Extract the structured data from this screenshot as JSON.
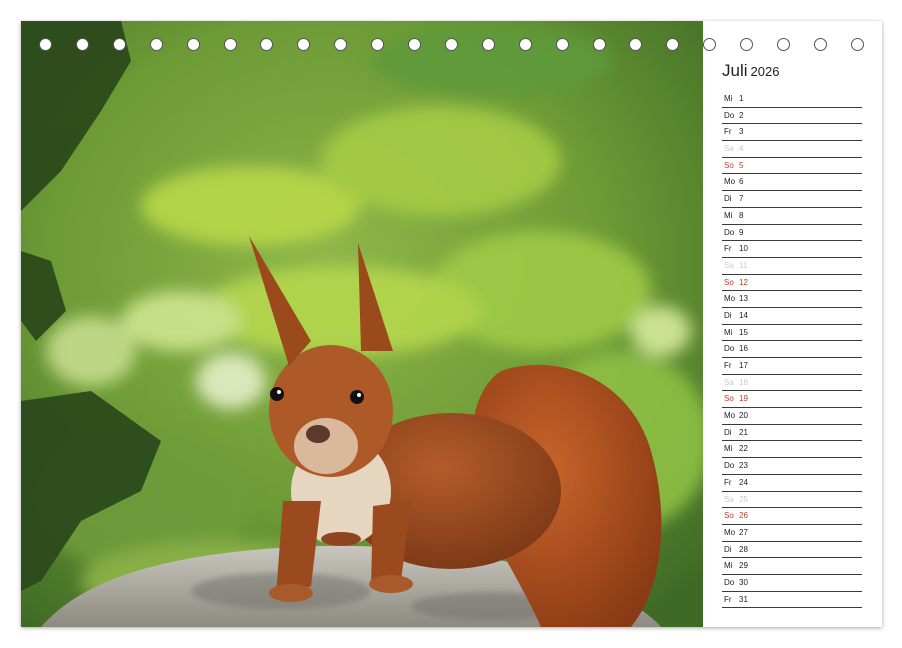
{
  "photo": {
    "subject": "red-squirrel-photo"
  },
  "calendar": {
    "month": "Juli",
    "year": "2026",
    "days": [
      {
        "wd": "Mi",
        "d": "1",
        "type": "normal"
      },
      {
        "wd": "Do",
        "d": "2",
        "type": "normal"
      },
      {
        "wd": "Fr",
        "d": "3",
        "type": "normal"
      },
      {
        "wd": "Sa",
        "d": "4",
        "type": "sat"
      },
      {
        "wd": "So",
        "d": "5",
        "type": "sun"
      },
      {
        "wd": "Mo",
        "d": "6",
        "type": "normal"
      },
      {
        "wd": "Di",
        "d": "7",
        "type": "normal"
      },
      {
        "wd": "Mi",
        "d": "8",
        "type": "normal"
      },
      {
        "wd": "Do",
        "d": "9",
        "type": "normal"
      },
      {
        "wd": "Fr",
        "d": "10",
        "type": "normal"
      },
      {
        "wd": "Sa",
        "d": "11",
        "type": "sat"
      },
      {
        "wd": "So",
        "d": "12",
        "type": "sun"
      },
      {
        "wd": "Mo",
        "d": "13",
        "type": "normal"
      },
      {
        "wd": "Di",
        "d": "14",
        "type": "normal"
      },
      {
        "wd": "Mi",
        "d": "15",
        "type": "normal"
      },
      {
        "wd": "Do",
        "d": "16",
        "type": "normal"
      },
      {
        "wd": "Fr",
        "d": "17",
        "type": "normal"
      },
      {
        "wd": "Sa",
        "d": "18",
        "type": "sat"
      },
      {
        "wd": "So",
        "d": "19",
        "type": "sun"
      },
      {
        "wd": "Mo",
        "d": "20",
        "type": "normal"
      },
      {
        "wd": "Di",
        "d": "21",
        "type": "normal"
      },
      {
        "wd": "Mi",
        "d": "22",
        "type": "normal"
      },
      {
        "wd": "Do",
        "d": "23",
        "type": "normal"
      },
      {
        "wd": "Fr",
        "d": "24",
        "type": "normal"
      },
      {
        "wd": "Sa",
        "d": "25",
        "type": "sat"
      },
      {
        "wd": "So",
        "d": "26",
        "type": "sun"
      },
      {
        "wd": "Mo",
        "d": "27",
        "type": "normal"
      },
      {
        "wd": "Di",
        "d": "28",
        "type": "normal"
      },
      {
        "wd": "Mi",
        "d": "29",
        "type": "normal"
      },
      {
        "wd": "Do",
        "d": "30",
        "type": "normal"
      },
      {
        "wd": "Fr",
        "d": "31",
        "type": "normal"
      }
    ]
  },
  "colors": {
    "sunday": "#c0392b",
    "saturday": "#c9c9c9",
    "foliage": "#7fb33a",
    "fur": "#a8521f"
  }
}
